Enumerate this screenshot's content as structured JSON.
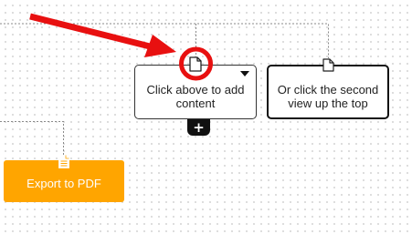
{
  "canvas": {
    "nodes": [
      {
        "text": "Click above to add content",
        "icon": "document-icon",
        "has_dropdown": true
      },
      {
        "text": "Or click the second view up the top",
        "icon": "document-icon",
        "has_dropdown": false
      }
    ],
    "add_button": {
      "label": "+",
      "icon": "plus-icon"
    }
  },
  "export": {
    "label": "Export to PDF",
    "icon": "pdf-document-icon",
    "color": "#ffa500"
  },
  "annotation": {
    "arrow_color": "#e81010",
    "circle_color": "#e81010"
  }
}
